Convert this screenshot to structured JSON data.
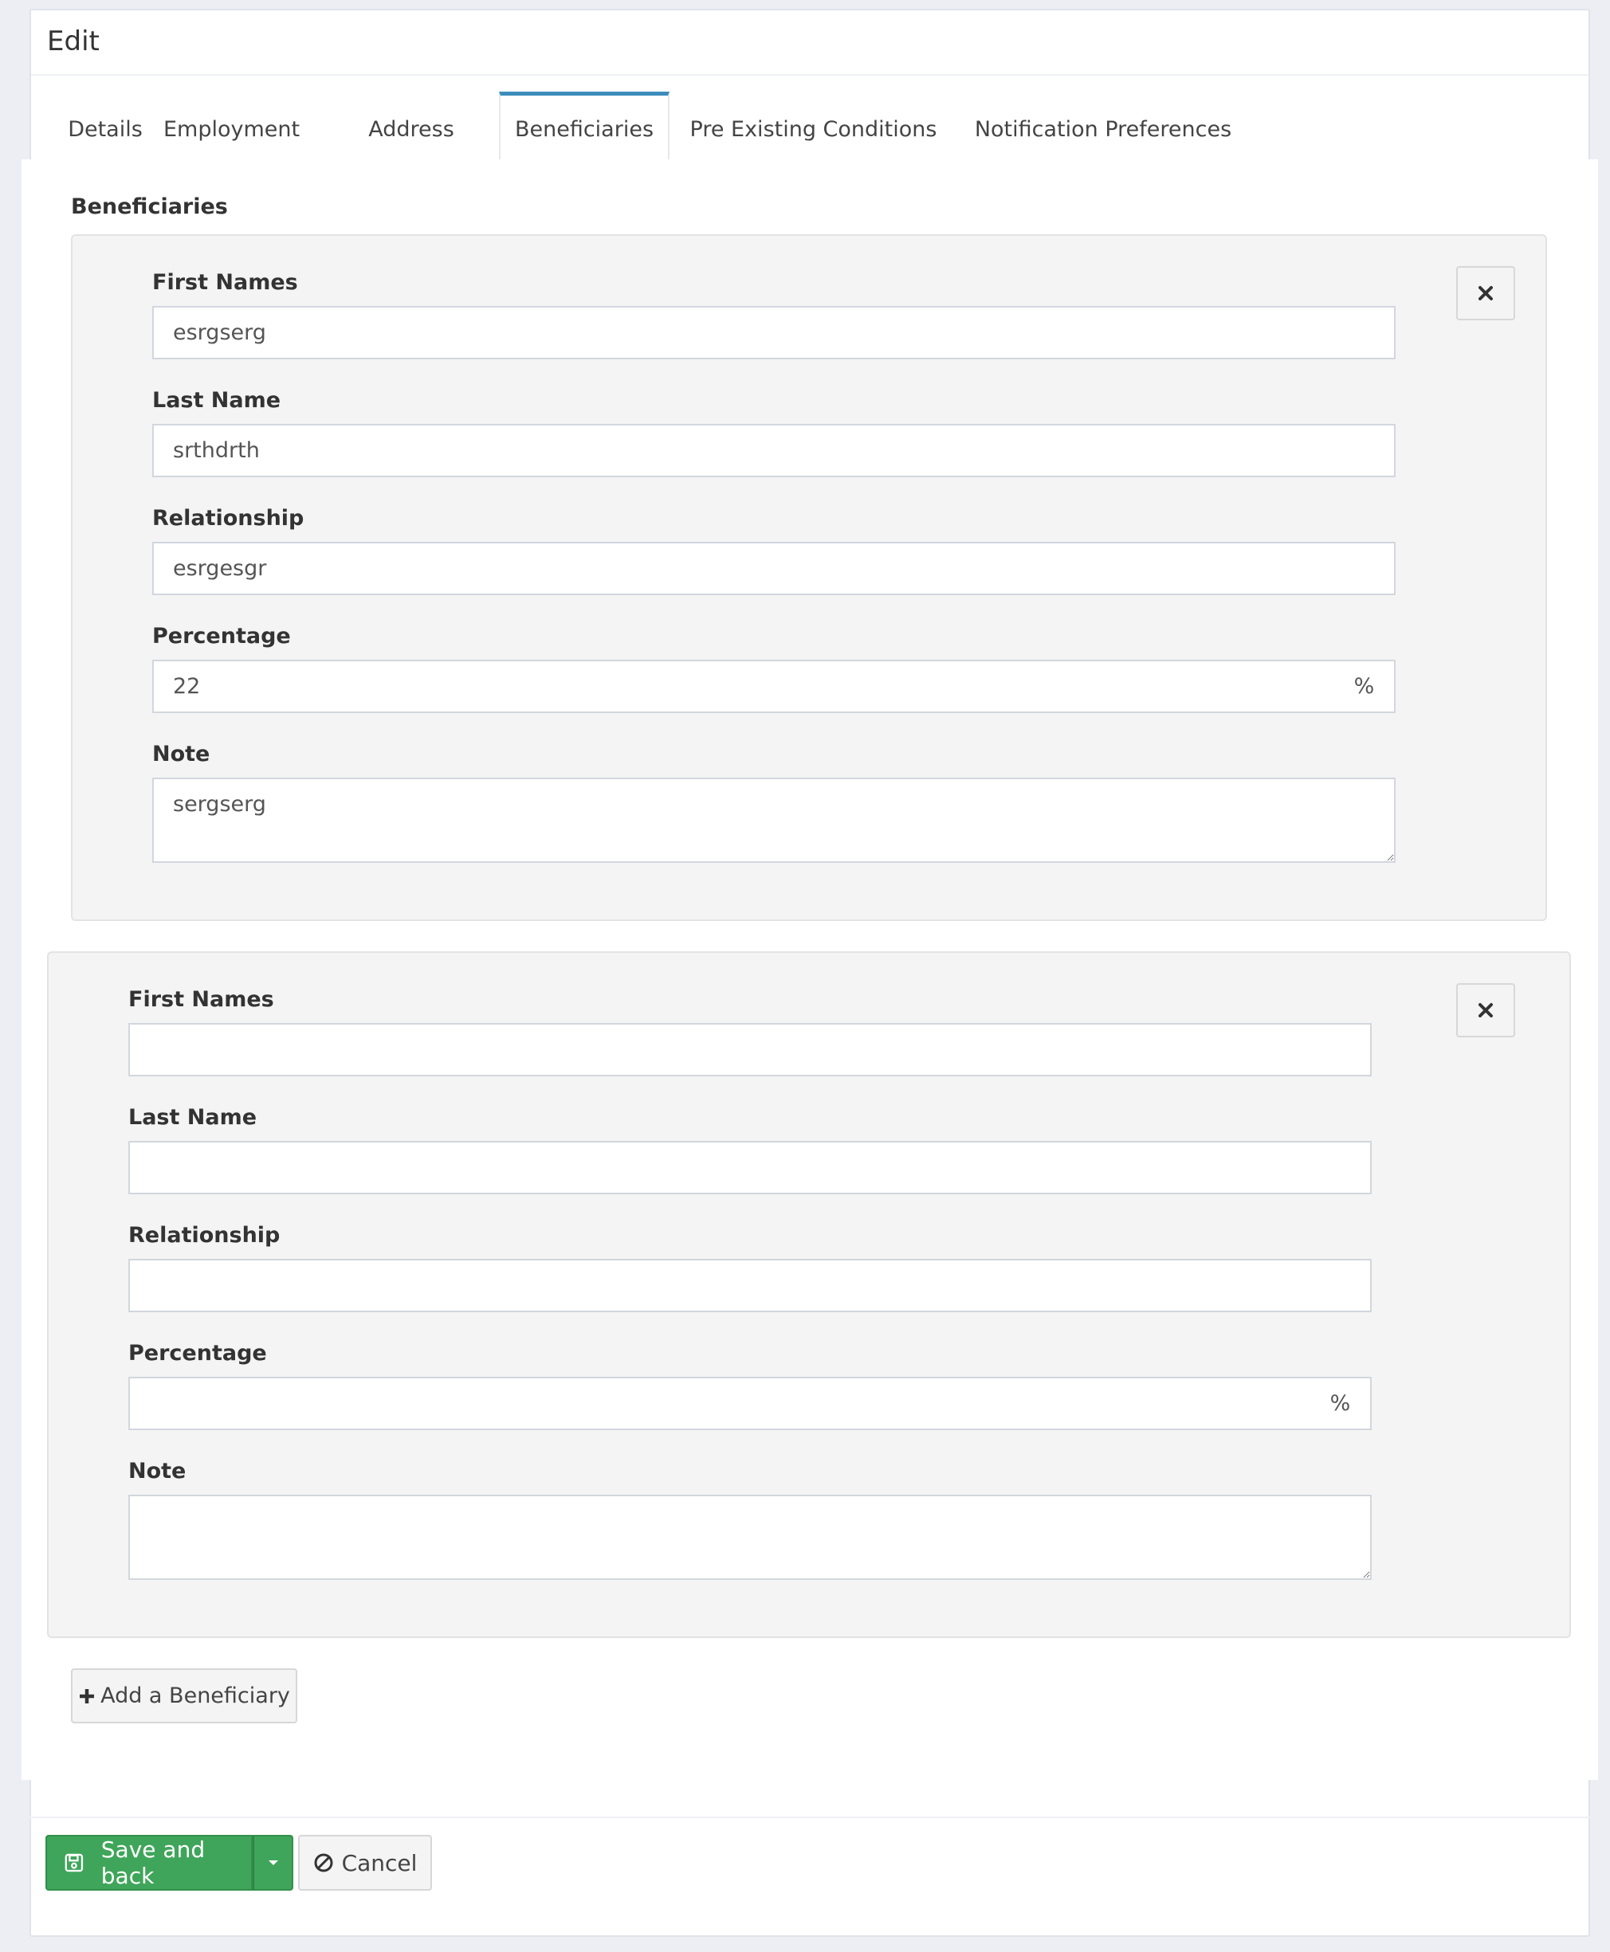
{
  "header": {
    "title": "Edit"
  },
  "tabs": [
    {
      "label": "Details",
      "active": false
    },
    {
      "label": "Employment",
      "active": false
    },
    {
      "label": "Address",
      "active": false
    },
    {
      "label": "Beneficiaries",
      "active": true
    },
    {
      "label": "Pre Existing Conditions",
      "active": false
    },
    {
      "label": "Notification Preferences",
      "active": false
    }
  ],
  "beneficiaries": {
    "section_label": "Beneficiaries",
    "labels": {
      "first_names": "First Names",
      "last_name": "Last Name",
      "relationship": "Relationship",
      "percentage": "Percentage",
      "note": "Note",
      "percent_suffix": "%"
    },
    "items": [
      {
        "first_names": "esrgserg",
        "last_name": "srthdrth",
        "relationship": "esrgesgr",
        "percentage": "22",
        "note": "sergserg"
      },
      {
        "first_names": "",
        "last_name": "",
        "relationship": "",
        "percentage": "",
        "note": ""
      }
    ],
    "add_button_label": "Add a Beneficiary"
  },
  "footer": {
    "save_label": "Save and back",
    "cancel_label": "Cancel"
  },
  "icons": {
    "remove": "times-icon",
    "add": "plus-icon",
    "save": "floppy-disk-icon",
    "dropdown": "caret-down-icon",
    "cancel": "ban-icon"
  },
  "colors": {
    "tab_accent": "#3c8dbc",
    "save_button": "#3fa55a",
    "card_background": "#f4f4f4",
    "page_background": "#eceef3"
  }
}
